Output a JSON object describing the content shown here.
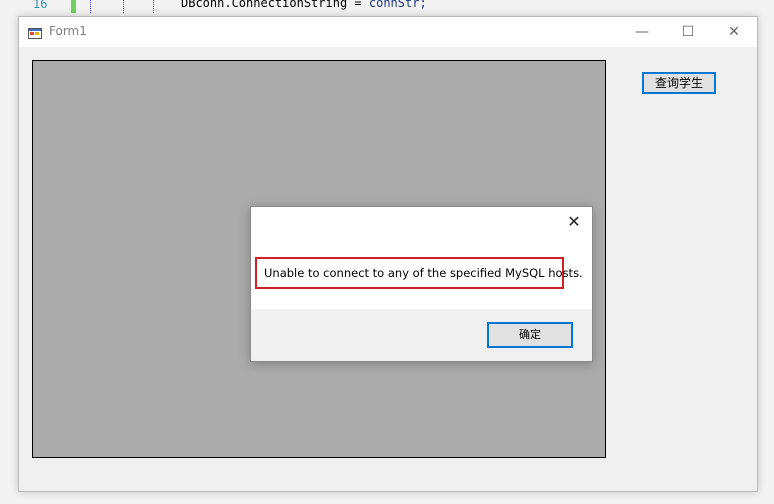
{
  "ide": {
    "line_number": "16",
    "code_object": "DBconn",
    "code_property": ".ConnectionString",
    "code_operator": " = ",
    "code_value": "connStr;"
  },
  "window": {
    "title": "Form1",
    "minimize_glyph": "—",
    "maximize_glyph": "☐",
    "close_glyph": "✕"
  },
  "form": {
    "query_button_label": "查询学生"
  },
  "messagebox": {
    "close_glyph": "✕",
    "message": "Unable to connect to any of the specified MySQL hosts.",
    "ok_label": "确定"
  },
  "colors": {
    "accent": "#0078d7",
    "error_highlight": "#d0202a",
    "panel_gray": "#ababab"
  }
}
